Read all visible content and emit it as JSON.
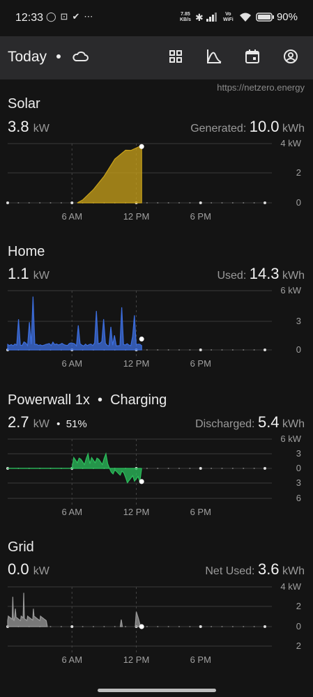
{
  "status": {
    "time": "12:33",
    "speed_top": "7.85",
    "speed_bottom": "KB/s",
    "vo_top": "Vo",
    "vo_bottom": "WiFi",
    "battery": "90%"
  },
  "header": {
    "title": "Today",
    "url": "https://netzero.energy"
  },
  "icons": [
    "cloud-icon",
    "grid-view-icon",
    "chart-icon",
    "calendar-icon",
    "account-icon"
  ],
  "time_axis": [
    "6 AM",
    "12 PM",
    "6 PM"
  ],
  "solar": {
    "title": "Solar",
    "power": "3.8",
    "power_unit": "kW",
    "total_label": "Generated:",
    "total": "10.0",
    "total_unit": "kWh",
    "y_ticks": [
      "4 kW",
      "2",
      "0"
    ],
    "color": "#c9a21a"
  },
  "home": {
    "title": "Home",
    "power": "1.1",
    "power_unit": "kW",
    "total_label": "Used:",
    "total": "14.3",
    "total_unit": "kWh",
    "y_ticks": [
      "6 kW",
      "3",
      "0"
    ],
    "color": "#3d6fe0"
  },
  "powerwall": {
    "title": "Powerwall 1x",
    "status": "Charging",
    "power": "2.7",
    "power_unit": "kW",
    "soc": "51%",
    "total_label": "Discharged:",
    "total": "5.4",
    "total_unit": "kWh",
    "y_ticks": [
      "6 kW",
      "3",
      "0",
      "3",
      "6"
    ],
    "color": "#2bbf5c"
  },
  "grid": {
    "title": "Grid",
    "power": "0.0",
    "power_unit": "kW",
    "total_label": "Net Used:",
    "total": "3.6",
    "total_unit": "kWh",
    "y_ticks": [
      "4 kW",
      "2",
      "0",
      "2"
    ],
    "color": "#9a9a9a"
  },
  "chart_data": [
    {
      "type": "area",
      "name": "Solar",
      "x_hours": [
        0,
        6.5,
        7,
        8,
        9,
        10,
        11,
        11.5,
        12.5
      ],
      "values": [
        0,
        0,
        0.2,
        0.9,
        1.8,
        3.0,
        3.5,
        3.6,
        3.8
      ],
      "ylim": [
        0,
        4
      ]
    },
    {
      "type": "area",
      "name": "Home",
      "ylim": [
        0,
        6
      ]
    },
    {
      "type": "area",
      "name": "Powerwall 1x",
      "ylim": [
        -6,
        6
      ]
    },
    {
      "type": "area",
      "name": "Grid",
      "ylim": [
        -2,
        4
      ]
    }
  ]
}
